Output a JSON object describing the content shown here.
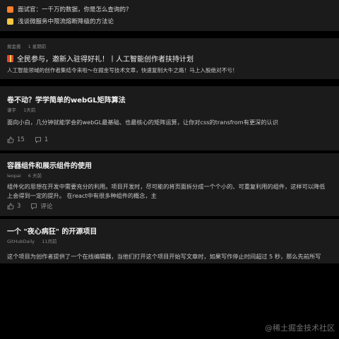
{
  "hot_list": [
    {
      "text": "面试官：一千万的数据，你是怎么查询的?",
      "badge": "orange"
    },
    {
      "text": "浅谈微服务中限流熔断降级的方法论",
      "badge": "yellow"
    }
  ],
  "promo": {
    "author": "掘金酱",
    "time": "1 星期前",
    "title": "全民参与，邀新入驻得好礼！丨人工智能创作者扶持计划",
    "summary": "人工智能领域的创作者集结令来啦～在掘金写技术文章，快速复制大牛之路！马上入股绝对不亏！"
  },
  "articles": [
    {
      "title": "卷不动？学学简单的webGL矩阵算法",
      "author": "谦宇",
      "time": "1天前",
      "summary": "面向小白，几分钟就能学会的webGL最基础、也最核心的矩阵运算，让你对css的transfrom有更深的认识",
      "likes": "15",
      "comments": "1"
    },
    {
      "title": "容器组件和展示组件的使用",
      "author": "leopai",
      "time": "6 天前",
      "summary_line1": "组件化的思想在开发中需要充分的利用。项目开发时，尽可能的将页面拆分成一个个小的、可重复利用的组件，这样可以降低",
      "summary_line2": "上会得到一定的提升。 在react中有很多种组件的概念，主",
      "likes": "3",
      "comments": "评论"
    },
    {
      "title": "一个 \"夜心病狂\" 的开源项目",
      "author": "GitHubDaily",
      "time": "11月前",
      "summary": "这个项目为创作者提供了一个在线编辑器，当他们打开这个项目开始写文章时，如果写作停止时间超过 5 秒，那么先前所写"
    }
  ],
  "watermark": "@稀土掘金技术社区",
  "colors": {
    "background": "#000000",
    "card": "#1b1b1b",
    "hot_badge_1": "#ff7f2a",
    "hot_badge_2": "#f7c744"
  },
  "icons": {
    "like": "thumbs-up-icon",
    "comment": "comment-icon",
    "promo_badge": "gift-icon"
  }
}
